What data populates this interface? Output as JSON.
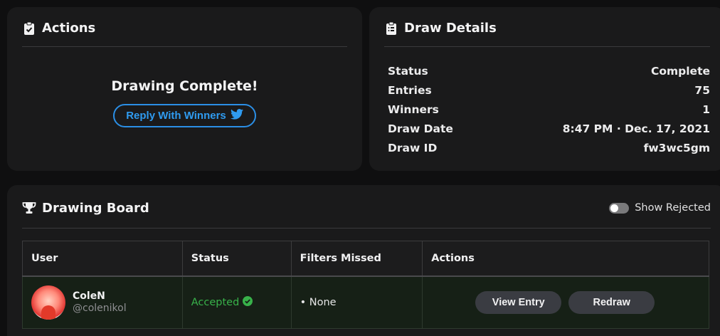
{
  "actions_card": {
    "title": "Actions",
    "icon": "clipboard-check-icon",
    "status_text": "Drawing Complete!",
    "reply_button_label": "Reply With Winners",
    "reply_button_icon": "twitter-bird-icon",
    "accent_color": "#2b8fe6"
  },
  "details_card": {
    "title": "Draw Details",
    "icon": "clipboard-list-icon",
    "rows": [
      {
        "label": "Status",
        "value": "Complete"
      },
      {
        "label": "Entries",
        "value": "75"
      },
      {
        "label": "Winners",
        "value": "1"
      },
      {
        "label": "Draw Date",
        "value": "8:47 PM · Dec. 17, 2021"
      },
      {
        "label": "Draw ID",
        "value": "fw3wc5gm"
      }
    ]
  },
  "board_card": {
    "title": "Drawing Board",
    "icon": "trophy-icon",
    "toggle_label": "Show Rejected",
    "toggle_on": false,
    "columns": [
      "User",
      "Status",
      "Filters Missed",
      "Actions"
    ],
    "rows": [
      {
        "name": "ColeN",
        "handle": "@colenikol",
        "status": "Accepted",
        "status_color": "#38b24a",
        "filters_missed": "• None",
        "view_label": "View Entry",
        "redraw_label": "Redraw"
      }
    ]
  }
}
